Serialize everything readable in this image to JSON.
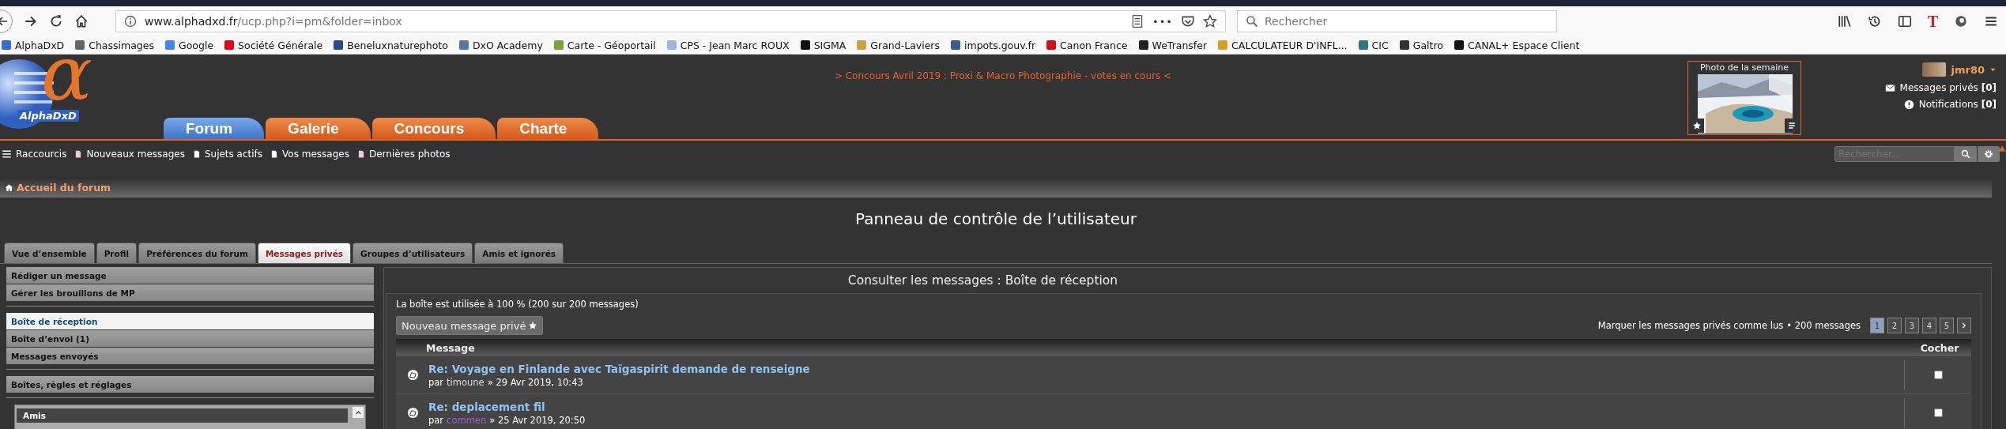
{
  "browser": {
    "url_host": "www.alphadxd.fr",
    "url_path": "/ucp.php?i=pm&folder=inbox",
    "more": "•••",
    "extension_letter": "T",
    "search_placeholder": "Rechercher",
    "bookmarks": [
      {
        "label": "AlphaDxD",
        "color": "#3a6fc9"
      },
      {
        "label": "Chassimages",
        "color": "#666666"
      },
      {
        "label": "Google",
        "color": "#4285f4"
      },
      {
        "label": "Société Générale",
        "color": "#e2001a"
      },
      {
        "label": "Beneluxnaturephoto",
        "color": "#2b4a8a"
      },
      {
        "label": "DxO Academy",
        "color": "#5577aa"
      },
      {
        "label": "Carte - Géoportail",
        "color": "#7aa33a"
      },
      {
        "label": "CPS - Jean Marc ROUX",
        "color": "#9db8d9"
      },
      {
        "label": "SIGMA",
        "color": "#111111"
      },
      {
        "label": "Grand-Laviers",
        "color": "#c8a23a"
      },
      {
        "label": "impots.gouv.fr",
        "color": "#3a5a8a"
      },
      {
        "label": "Canon France",
        "color": "#d0101a"
      },
      {
        "label": "WeTransfer",
        "color": "#222222"
      },
      {
        "label": "CALCULATEUR D'INFL...",
        "color": "#d8a020"
      },
      {
        "label": "CIC",
        "color": "#2a7a8a"
      },
      {
        "label": "Galtro",
        "color": "#333333"
      },
      {
        "label": "CANAL+ Espace Client",
        "color": "#111111"
      }
    ]
  },
  "header": {
    "logo_symbol": "α",
    "logo_name": "AlphaDxD",
    "announcement": "> Concours Avril 2019 : Proxi & Macro Photographie - votes en cours <",
    "nav_tabs": [
      {
        "label": "Forum",
        "selected": true
      },
      {
        "label": "Galerie",
        "selected": false
      },
      {
        "label": "Concours",
        "selected": false
      },
      {
        "label": "Charte",
        "selected": false
      }
    ],
    "photo_of_week": {
      "title": "Photo de la semaine",
      "kind": "picture"
    },
    "user": {
      "name": "jmr80"
    },
    "messages": {
      "label": "Messages privés",
      "count": "[0]"
    },
    "notifications": {
      "label": "Notifications",
      "count": "[0]"
    }
  },
  "quicklinks": [
    {
      "label": "Raccourcis",
      "kind": "menu"
    },
    {
      "label": "Nouveaux messages",
      "kind": "new"
    },
    {
      "label": "Sujets actifs",
      "kind": "page"
    },
    {
      "label": "Vos messages",
      "kind": "page"
    },
    {
      "label": "Dernières photos",
      "kind": "new"
    }
  ],
  "search_placeholder": "Rechercher…",
  "breadcrumb": "Accueil du forum",
  "page_title": "Panneau de contrôle de l’utilisateur",
  "ucp_tabs": [
    {
      "label": "Vue d’ensemble",
      "selected": false
    },
    {
      "label": "Profil",
      "selected": false
    },
    {
      "label": "Préférences du forum",
      "selected": false
    },
    {
      "label": "Messages privés",
      "selected": true
    },
    {
      "label": "Groupes d’utilisateurs",
      "selected": false
    },
    {
      "label": "Amis et ignorés",
      "selected": false
    }
  ],
  "sidebar": {
    "groups": [
      [
        {
          "label": "Rédiger un message",
          "selected": false
        },
        {
          "label": "Gérer les brouillons de MP",
          "selected": false
        }
      ],
      [
        {
          "label": "Boîte de réception",
          "selected": true
        },
        {
          "label": "Boîte d’envoi (1)",
          "selected": false
        },
        {
          "label": "Messages envoyés",
          "selected": false
        }
      ],
      [
        {
          "label": "Boîtes, règles et réglages",
          "selected": false
        }
      ]
    ],
    "friends_title": "Amis"
  },
  "main": {
    "title": "Consulter les messages : Boîte de réception",
    "usage": "La boîte est utilisée à 100 % (200 sur 200 messages)",
    "new_button": "Nouveau message privé",
    "mark_read": "Marquer les messages privés comme lus",
    "total": "• 200 messages",
    "pages": [
      {
        "label": "1",
        "selected": true
      },
      {
        "label": "2",
        "selected": false
      },
      {
        "label": "3",
        "selected": false
      },
      {
        "label": "4",
        "selected": false
      },
      {
        "label": "5",
        "selected": false
      }
    ],
    "columns": [
      "Message",
      "Cocher"
    ],
    "rows": [
      {
        "title": "Re: Voyage en Finlande avec Taïgaspirit demande de renseigne",
        "by": "par",
        "author": "timoune",
        "date": "» 29 Avr 2019, 10:43",
        "color": "#dddddd",
        "checked": false
      },
      {
        "title": "Re: deplacement fil",
        "by": "par",
        "author": "commen",
        "date": "» 25 Avr 2019, 20:50",
        "color": "#a060d0",
        "checked": false
      }
    ]
  }
}
